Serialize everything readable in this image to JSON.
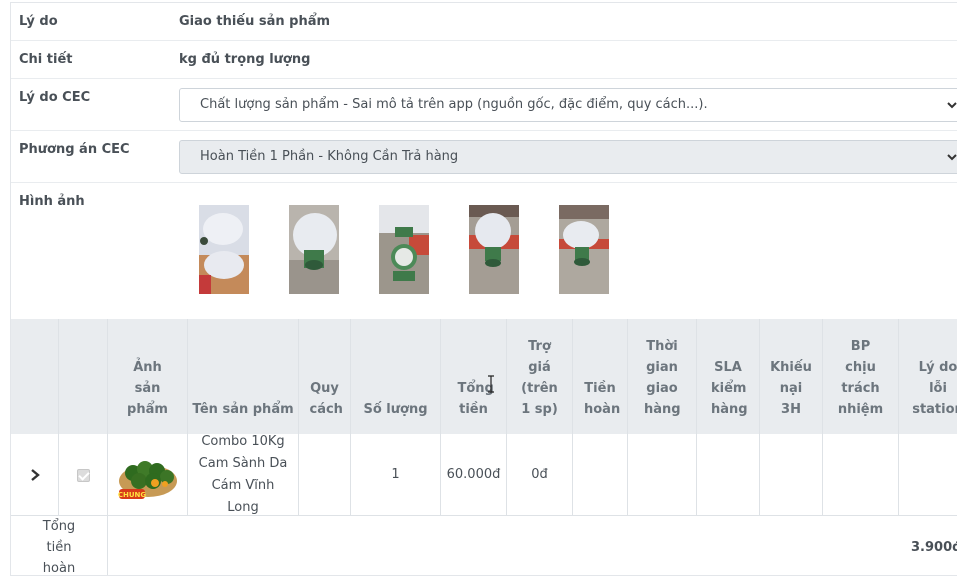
{
  "form": {
    "reason_label": "Lý do",
    "reason_value": "Giao thiếu sản phẩm",
    "detail_label": "Chi tiết",
    "detail_value": "kg đủ trọng lượng",
    "cec_reason_label": "Lý do CEC",
    "cec_reason_selected": "Chất lượng sản phẩm - Sai mô tả trên app (nguồn gốc, đặc điểm, quy cách...).",
    "cec_plan_label": "Phương án CEC",
    "cec_plan_selected": "Hoàn Tiền 1 Phần - Không Cần Trả hàng",
    "images_label": "Hình ảnh",
    "image_count": 5
  },
  "table": {
    "headers": [
      "",
      "",
      "Ảnh sản phẩm",
      "Tên sản phẩm",
      "Quy cách",
      "Số lượng",
      "Tổng tiền",
      "Trợ giá (trên 1 sp)",
      "Tiền hoàn",
      "Thời gian giao hàng",
      "SLA kiểm hàng",
      "Khiếu nại 3H",
      "BP chịu trách nhiệm",
      "Lý do lỗi station"
    ],
    "row": {
      "product_name": "Combo 10Kg Cam Sành Da Cám Vĩnh Long",
      "spec": "",
      "quantity": "1",
      "total": "60.000đ",
      "subsidy": "0đ",
      "refund": "",
      "delivery_time": "",
      "sla": "",
      "complaint_3h": "",
      "department": "",
      "station_reason": "",
      "product_badge": "CHUNG"
    },
    "footer_label": "Tổng tiền hoàn",
    "footer_value": "3.900đ"
  },
  "colors": {
    "header_bg": "#e9ecef",
    "border": "#dee2e6",
    "text": "#495057"
  }
}
